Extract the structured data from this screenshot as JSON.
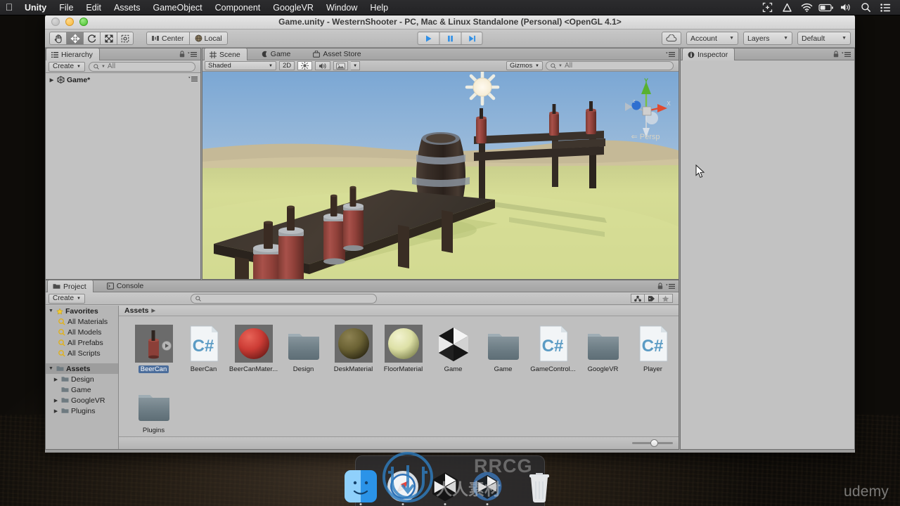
{
  "menubar": {
    "apple": "apple-logo",
    "items": [
      {
        "label": "Unity",
        "bold": true
      },
      {
        "label": "File",
        "bold": false
      },
      {
        "label": "Edit",
        "bold": false
      },
      {
        "label": "Assets",
        "bold": false
      },
      {
        "label": "GameObject",
        "bold": false
      },
      {
        "label": "Component",
        "bold": false
      },
      {
        "label": "GoogleVR",
        "bold": false
      },
      {
        "label": "Window",
        "bold": false
      },
      {
        "label": "Help",
        "bold": false
      }
    ],
    "status_icons": [
      "screenshot-icon",
      "google-drive-icon",
      "wifi-icon",
      "battery-icon",
      "volume-icon",
      "search-icon",
      "notification-center-icon"
    ]
  },
  "window": {
    "title": "Game.unity - WesternShooter - PC, Mac & Linux Standalone (Personal) <OpenGL 4.1>"
  },
  "toolbar": {
    "tools": [
      "hand-tool",
      "move-tool",
      "rotate-tool",
      "scale-tool",
      "rect-tool"
    ],
    "selected_tool": "move-tool",
    "pivot_label": "Center",
    "space_label": "Local",
    "play_label": "play-button",
    "pause_label": "pause-button",
    "step_label": "step-button",
    "cloud_label": "cloud-button",
    "account_label": "Account",
    "layers_label": "Layers",
    "layout_label": "Default"
  },
  "hierarchy": {
    "tab": "Hierarchy",
    "create_label": "Create",
    "search_placeholder": "All",
    "items": [
      {
        "label": "Game*",
        "icon": "unity-scene-icon",
        "expanded": false
      }
    ]
  },
  "scene": {
    "tabs": [
      {
        "label": "Scene",
        "icon": "scene-icon",
        "active": true
      },
      {
        "label": "Game",
        "icon": "game-icon",
        "active": false
      },
      {
        "label": "Asset Store",
        "icon": "asset-store-icon",
        "active": false
      }
    ],
    "draw_mode": "Shaded",
    "two_d_label": "2D",
    "lighting_icon": "lighting-toggle-icon",
    "audio_icon": "audio-toggle-icon",
    "effects_icon": "effects-toggle-icon",
    "gizmos_label": "Gizmos",
    "search_placeholder": "All",
    "gizmo": {
      "axis_y": "Y",
      "axis_x": "X",
      "perspective_label": "Persp"
    }
  },
  "inspector": {
    "tab": "Inspector",
    "empty": true
  },
  "project": {
    "tabs": [
      {
        "label": "Project",
        "icon": "project-folder-icon",
        "active": true
      },
      {
        "label": "Console",
        "icon": "console-icon",
        "active": false
      }
    ],
    "create_label": "Create",
    "search_placeholder": "",
    "breadcrumb": "Assets",
    "tree": [
      {
        "label": "Favorites",
        "type": "favorites-root",
        "depth": 0,
        "expanded": true
      },
      {
        "label": "All Materials",
        "type": "saved-search",
        "depth": 1
      },
      {
        "label": "All Models",
        "type": "saved-search",
        "depth": 1
      },
      {
        "label": "All Prefabs",
        "type": "saved-search",
        "depth": 1
      },
      {
        "label": "All Scripts",
        "type": "saved-search",
        "depth": 1
      },
      {
        "label": "Assets",
        "type": "folder",
        "depth": 0,
        "expanded": true,
        "selected": true
      },
      {
        "label": "Design",
        "type": "folder",
        "depth": 1,
        "expanded": false
      },
      {
        "label": "Game",
        "type": "folder",
        "depth": 1,
        "expanded": false,
        "no_arrow": true
      },
      {
        "label": "GoogleVR",
        "type": "folder",
        "depth": 1,
        "expanded": false
      },
      {
        "label": "Plugins",
        "type": "folder",
        "depth": 1,
        "expanded": false
      }
    ],
    "assets": [
      {
        "label": "BeerCan",
        "type": "prefab",
        "selected": true
      },
      {
        "label": "BeerCan",
        "type": "csharp"
      },
      {
        "label": "BeerCanMater...",
        "type": "material",
        "color": "#cc3c35"
      },
      {
        "label": "Design",
        "type": "folder"
      },
      {
        "label": "DeskMaterial",
        "type": "material",
        "color": "#6b6234"
      },
      {
        "label": "FloorMaterial",
        "type": "material",
        "color": "#dde0a6"
      },
      {
        "label": "Game",
        "type": "scene"
      },
      {
        "label": "Game",
        "type": "folder"
      },
      {
        "label": "GameControl...",
        "type": "csharp"
      },
      {
        "label": "GoogleVR",
        "type": "folder"
      },
      {
        "label": "Player",
        "type": "csharp"
      },
      {
        "label": "Plugins",
        "type": "folder"
      }
    ],
    "zoom_value": 45
  },
  "dock": {
    "items": [
      "finder-icon",
      "safari-icon",
      "unity-icon",
      "unity-hub-icon",
      "trash-icon"
    ]
  },
  "watermarks": {
    "rrcg": "RRCG",
    "udemy": "udemy"
  },
  "colors": {
    "accent": "#3f8fe0",
    "selection": "#4b6d9b",
    "panel_bg": "#c2c2c2",
    "sky": "#8fb5d8",
    "ground": "#d3dc92",
    "wood": "#3a2e26"
  }
}
